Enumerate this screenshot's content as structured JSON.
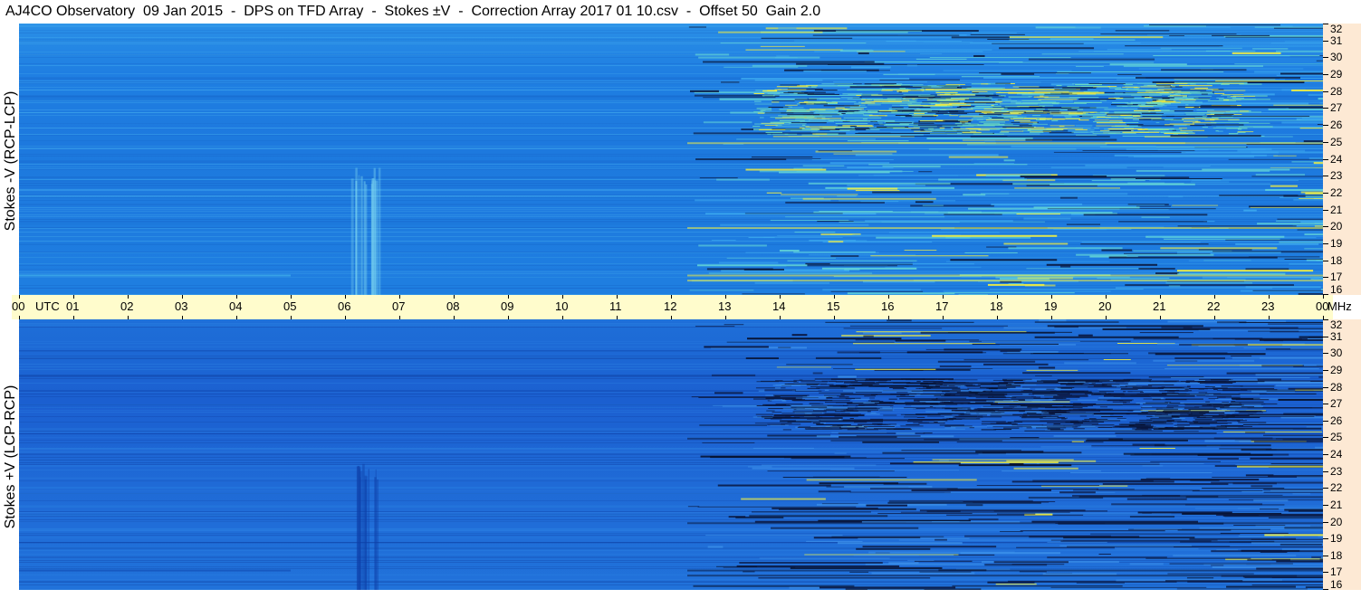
{
  "title": "AJ4CO Observatory  09 Jan 2015  -  DPS on TFD Array  -  Stokes ±V  -  Correction Array 2017 01 10.csv  -  Offset 50  Gain 2.0",
  "chart_data": [
    {
      "type": "heatmap",
      "panel": "upper",
      "ylabel": "Stokes -V (RCP-LCP)",
      "y_unit": "MHz",
      "y_range": [
        16,
        32
      ],
      "y_ticks": [
        "16",
        "17",
        "18",
        "19",
        "20",
        "21",
        "22",
        "23",
        "24",
        "25",
        "26",
        "27",
        "28",
        "29",
        "30",
        "31",
        "32"
      ],
      "x_range_utc": [
        0,
        24
      ],
      "colors": {
        "background": "#1f7fe2",
        "activity": "#5fd0d8",
        "strong": "#f4f040",
        "dark": "#0a1a40"
      }
    },
    {
      "type": "heatmap",
      "panel": "lower",
      "ylabel": "Stokes +V (LCP-RCP)",
      "y_unit": "MHz",
      "y_range": [
        16,
        32
      ],
      "y_ticks": [
        "16",
        "17",
        "18",
        "19",
        "20",
        "21",
        "22",
        "23",
        "24",
        "25",
        "26",
        "27",
        "28",
        "29",
        "30",
        "31",
        "32"
      ],
      "x_range_utc": [
        0,
        24
      ],
      "colors": {
        "background": "#1b5fd0",
        "activity": "#0a1740",
        "strong": "#f4f040",
        "dark": "#06102c"
      }
    }
  ],
  "time_axis": {
    "labels": [
      "00",
      "01",
      "02",
      "03",
      "04",
      "05",
      "06",
      "07",
      "08",
      "09",
      "10",
      "11",
      "12",
      "13",
      "14",
      "15",
      "16",
      "17",
      "18",
      "19",
      "20",
      "21",
      "22",
      "23",
      "00"
    ],
    "utc_label": "UTC",
    "mhz_label": "MHz"
  }
}
